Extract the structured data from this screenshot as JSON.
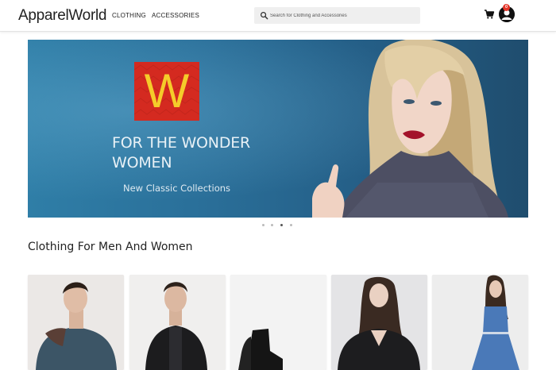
{
  "header": {
    "logo": "ApparelWorld",
    "nav": [
      "CLOTHING",
      "ACCESSORIES"
    ],
    "search_placeholder": "Search for Clothing and Accessories",
    "cart_icon": "shopping-cart-icon",
    "cart_count": "0",
    "avatar_icon": "user-avatar-icon"
  },
  "banner": {
    "logo_letter": "W",
    "title": "FOR THE WONDER WOMEN",
    "subtitle": "New Classic Collections",
    "slides": 4,
    "active_slide": 3
  },
  "section": {
    "title": "Clothing For Men And Women"
  },
  "colors": {
    "banner_blue": "#2a6f99",
    "w_logo_red": "#d42a20",
    "w_logo_yellow": "#f5cc2a",
    "badge_red": "#e4372b"
  },
  "products": [
    {
      "icon": "men-sweater-image"
    },
    {
      "icon": "men-jacket-image"
    },
    {
      "icon": "black-boots-image"
    },
    {
      "icon": "women-leather-jacket-image"
    },
    {
      "icon": "women-denim-dress-image"
    }
  ]
}
